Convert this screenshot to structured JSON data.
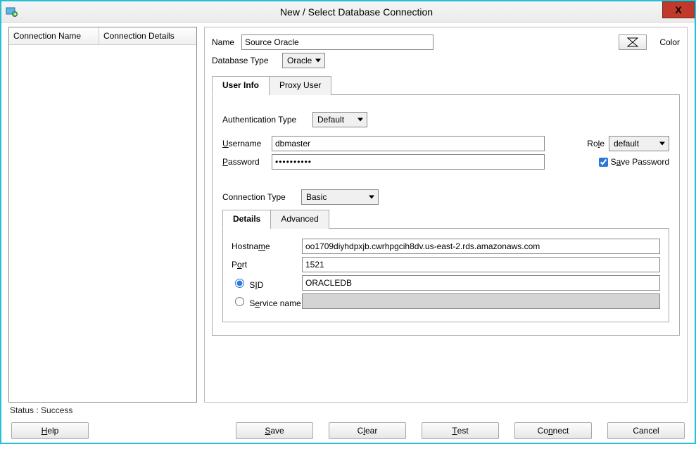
{
  "window": {
    "title": "New / Select Database Connection",
    "close_glyph": "X"
  },
  "left": {
    "col1": "Connection Name",
    "col2": "Connection Details"
  },
  "form": {
    "name_label": "Name",
    "name_value": "Source Oracle",
    "color_label": "Color",
    "dbtype_label": "Database Type",
    "dbtype_value": "Oracle"
  },
  "tabs": {
    "user_info": "User Info",
    "proxy_user": "Proxy User"
  },
  "userinfo": {
    "auth_label": "Authentication Type",
    "auth_value": "Default",
    "username_label": "Username",
    "username_value": "dbmaster",
    "role_label": "Role",
    "role_value": "default",
    "password_label": "Password",
    "password_value": "••••••••••",
    "save_pwd_label": "Save Password",
    "save_pwd_checked": true,
    "conntype_label": "Connection Type",
    "conntype_value": "Basic"
  },
  "details_tabs": {
    "details": "Details",
    "advanced": "Advanced"
  },
  "details": {
    "hostname_label": "Hostname",
    "hostname_value": "oo1709diyhdpxjb.cwrhpgcih8dv.us-east-2.rds.amazonaws.com",
    "port_label": "Port",
    "port_value": "1521",
    "sid_label": "SID",
    "sid_value": "ORACLEDB",
    "service_label": "Service name",
    "service_value": ""
  },
  "status": "Status : Success",
  "buttons": {
    "help": "Help",
    "save": "Save",
    "clear": "Clear",
    "test": "Test",
    "connect": "Connect",
    "cancel": "Cancel"
  }
}
